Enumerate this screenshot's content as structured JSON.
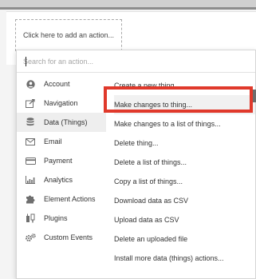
{
  "workflow": {
    "add_action_label": "Click here to add an action..."
  },
  "search": {
    "placeholder": "Search for an action...",
    "value": ""
  },
  "categories": [
    {
      "label": "Account",
      "icon": "user-icon"
    },
    {
      "label": "Navigation",
      "icon": "navigation-icon"
    },
    {
      "label": "Data (Things)",
      "icon": "database-icon",
      "selected": true
    },
    {
      "label": "Email",
      "icon": "email-icon"
    },
    {
      "label": "Payment",
      "icon": "credit-card-icon"
    },
    {
      "label": "Analytics",
      "icon": "analytics-icon"
    },
    {
      "label": "Element Actions",
      "icon": "puzzle-icon"
    },
    {
      "label": "Plugins",
      "icon": "plugin-icon"
    },
    {
      "label": "Custom Events",
      "icon": "gears-icon"
    }
  ],
  "actions": [
    {
      "label": "Create a new thing..."
    },
    {
      "label": "Make changes to thing...",
      "highlighted": true
    },
    {
      "label": "Make changes to a list of things..."
    },
    {
      "label": "Delete thing..."
    },
    {
      "label": "Delete a list of things..."
    },
    {
      "label": "Copy a list of things..."
    },
    {
      "label": "Download data as CSV"
    },
    {
      "label": "Upload data as CSV"
    },
    {
      "label": "Delete an uploaded file"
    },
    {
      "label": "Install more data (things) actions..."
    }
  ],
  "colors": {
    "highlight_border": "#e0392b",
    "selected_category_bg": "#eeeeee"
  }
}
